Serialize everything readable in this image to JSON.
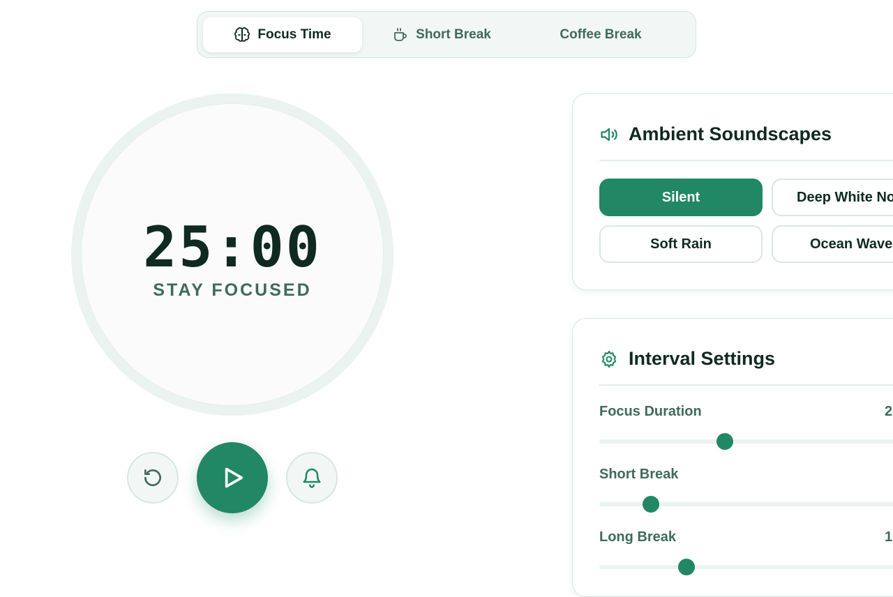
{
  "tabs": [
    {
      "label": "Focus Time",
      "icon": "brain-icon",
      "active": true
    },
    {
      "label": "Short Break",
      "icon": "coffee-cup-icon",
      "active": false
    },
    {
      "label": "Coffee Break",
      "icon": "",
      "active": false
    }
  ],
  "timer": {
    "time": "25:00",
    "status": "STAY FOCUSED"
  },
  "controls": {
    "reset_icon": "reset-icon",
    "play_icon": "play-icon",
    "bell_icon": "bell-icon"
  },
  "soundscapes": {
    "title": "Ambient Soundscapes",
    "icon": "speaker-icon",
    "options": [
      "Silent",
      "Deep White Noise",
      "Soft Rain",
      "Ocean Waves"
    ],
    "selected": "Silent"
  },
  "intervals": {
    "title": "Interval Settings",
    "icon": "gear-icon",
    "settings": [
      {
        "label": "Focus Duration",
        "value": "2",
        "level": 0.375
      },
      {
        "label": "Short Break",
        "value": "",
        "level": 0.155
      },
      {
        "label": "Long Break",
        "value": "1",
        "level": 0.26
      }
    ]
  },
  "colors": {
    "accent": "#218765",
    "text": "#0f2a20",
    "muted": "#3f6a5b",
    "track": "#eaf3ef"
  }
}
